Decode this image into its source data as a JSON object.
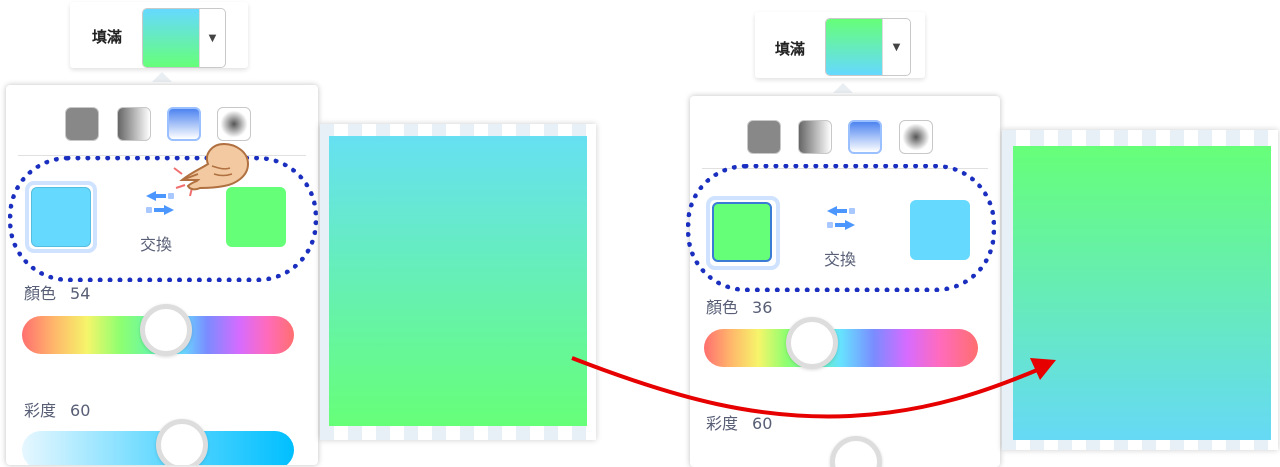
{
  "left": {
    "fill_label": "填滿",
    "swap_label": "交換",
    "color_label": "顏色",
    "color_value": "54",
    "saturation_label": "彩度",
    "saturation_value": "60",
    "color_slider_level": 0.54,
    "saturation_slider_level": 0.6,
    "color1": "#66d9ff",
    "color2": "#66ff78",
    "modes": [
      "solid-fill-icon",
      "horizontal-gradient-icon",
      "vertical-gradient-icon",
      "radial-gradient-icon"
    ],
    "selected_mode": "vertical-gradient-icon"
  },
  "right": {
    "fill_label": "填滿",
    "swap_label": "交換",
    "color_label": "顏色",
    "color_value": "36",
    "saturation_label": "彩度",
    "saturation_value": "60",
    "color_slider_level": 0.36,
    "color1": "#66ff78",
    "color2": "#66d9ff",
    "modes": [
      "solid-fill-icon",
      "horizontal-gradient-icon",
      "vertical-gradient-icon",
      "radial-gradient-icon"
    ],
    "selected_mode": "vertical-gradient-icon"
  },
  "annotations": {
    "highlight_color": "#1a2fbf",
    "arrow_color": "#e60000",
    "pointer": "pointing-hand-icon"
  }
}
